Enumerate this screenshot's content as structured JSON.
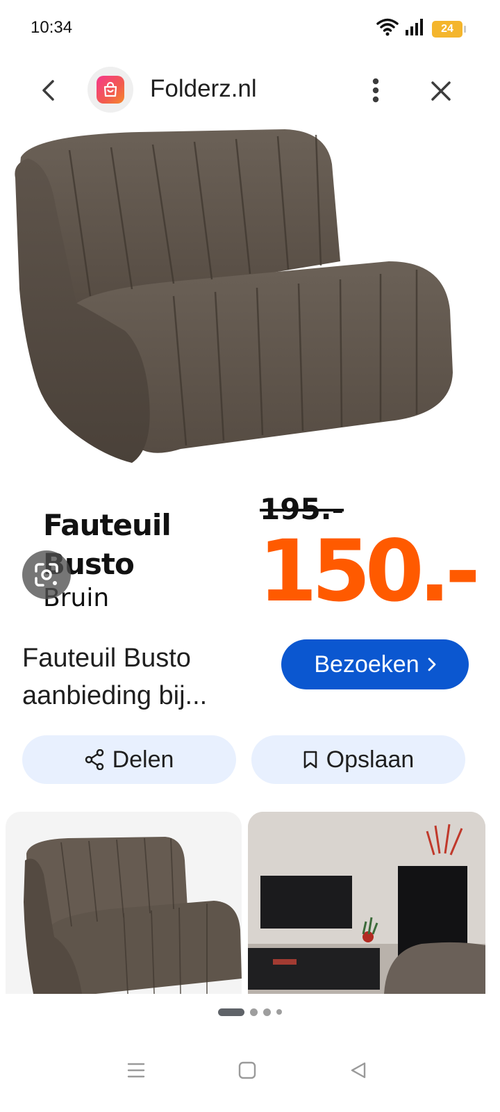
{
  "status_bar": {
    "time": "10:34",
    "battery": "24",
    "battery_color": "#f4b52c",
    "icons": [
      "wifi-icon",
      "signal-icon",
      "battery-icon"
    ]
  },
  "header": {
    "site_name": "Folderz.nl",
    "icons": [
      "back-arrow-icon",
      "folderz-logo-icon",
      "more-vert-icon",
      "close-icon"
    ]
  },
  "product_image": {
    "title": "Fauteuil Busto",
    "subtitle": "Bruin",
    "old_price": "195.-",
    "new_price": "150.-",
    "price_color": "#ff5a00"
  },
  "result": {
    "title": "Fauteuil Busto aanbieding bij...",
    "visit_label": "Bezoeken",
    "visit_color": "#0b57d0"
  },
  "actions": {
    "share_label": "Delen",
    "save_label": "Opslaan"
  },
  "pager": {
    "current_page": 1,
    "total_dots": 4
  },
  "nav_bar": {
    "icons": [
      "menu-icon",
      "home-square-icon",
      "back-triangle-icon"
    ]
  }
}
